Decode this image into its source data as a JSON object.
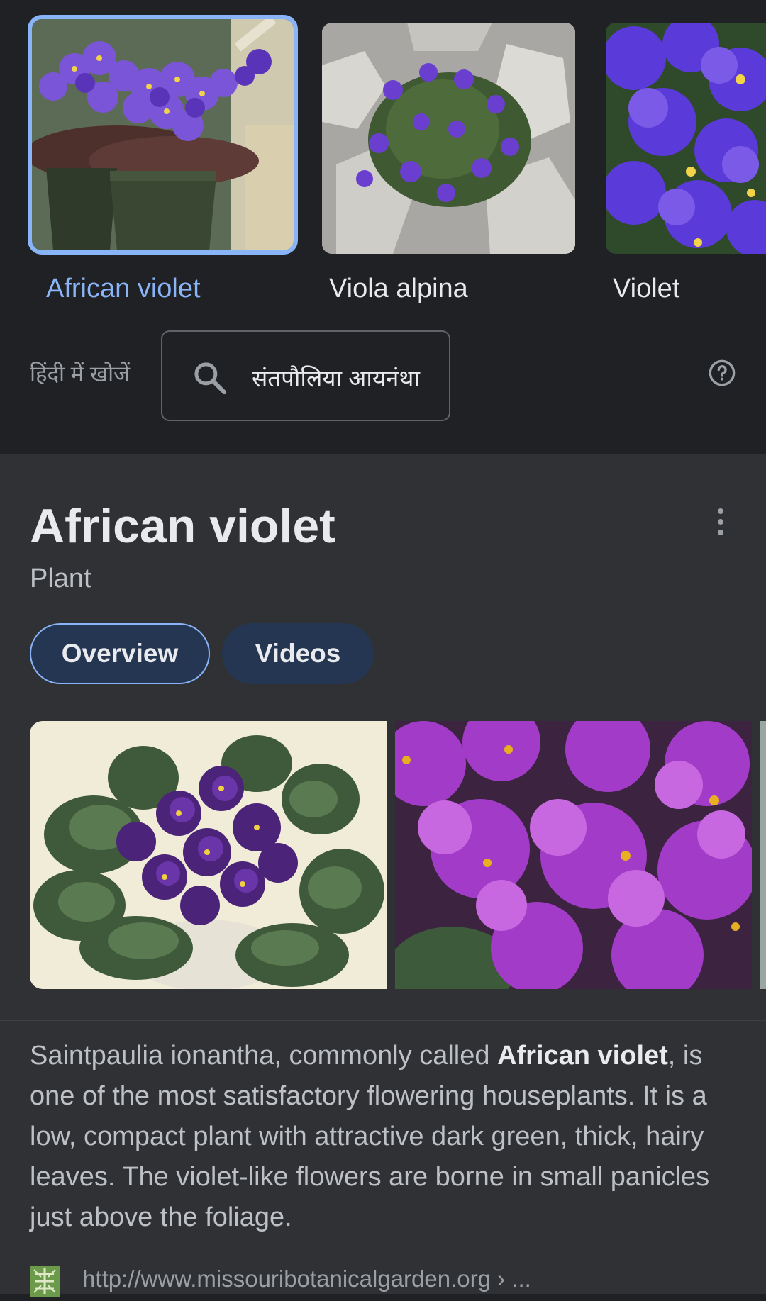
{
  "related_entities": [
    {
      "label": "African violet",
      "selected": true
    },
    {
      "label": "Viola alpina",
      "selected": false
    },
    {
      "label": "Violet",
      "selected": false
    }
  ],
  "hindi_search": {
    "label": "हिंदी में खोजें",
    "query": "संतपौलिया आयनंथा",
    "search_icon": "search-icon",
    "help_icon": "help-icon"
  },
  "knowledge_panel": {
    "title": "African violet",
    "subtitle": "Plant",
    "more_icon": "more-vert-icon",
    "tabs": [
      {
        "label": "Overview",
        "active": true
      },
      {
        "label": "Videos",
        "active": false
      }
    ],
    "description": {
      "before": "Saintpaulia ionantha, commonly called ",
      "bold": "African violet",
      "after": ", is one of the most satisfactory flowering houseplants. It is a low, compact plant with attractive dark green, thick, hairy leaves. The violet-like flowers are borne in small panicles just above the foliage."
    },
    "source": {
      "url": "http://www.missouribotanicalgarden.org › ..."
    }
  },
  "colors": {
    "background": "#202124",
    "panel": "#303134",
    "accent": "#8ab4f8",
    "tab_fill": "#253653"
  }
}
